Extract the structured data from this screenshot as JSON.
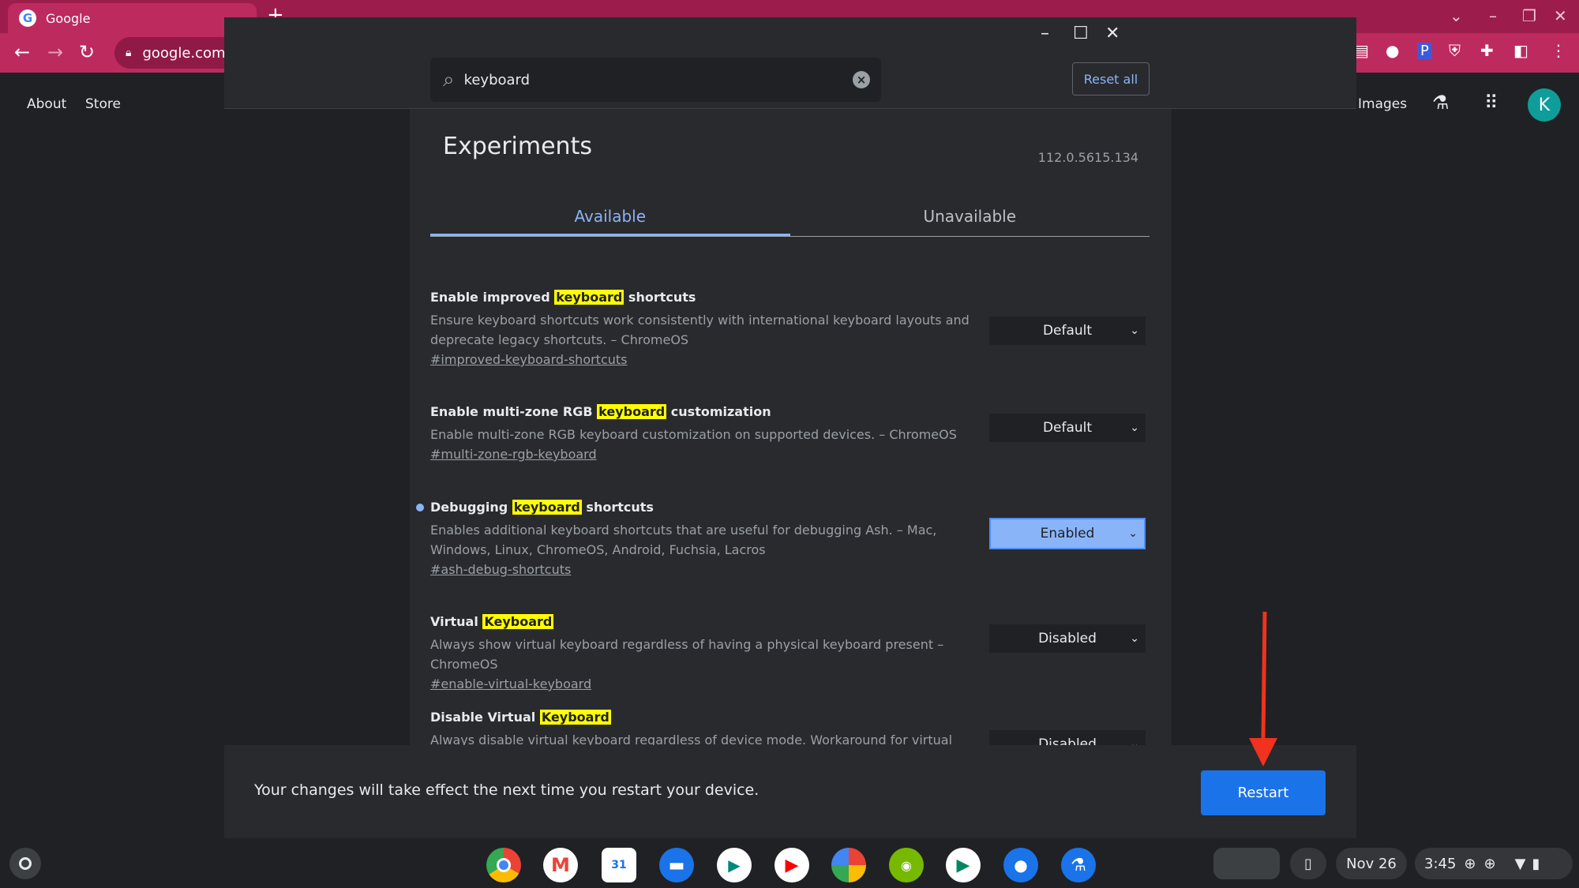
{
  "browser": {
    "tab_title": "Google",
    "url": "google.com",
    "page_links": [
      "About",
      "Store"
    ],
    "images_link": "Images",
    "avatar_letter": "K"
  },
  "flags": {
    "search_value": "keyboard",
    "reset_all_label": "Reset all",
    "title": "Experiments",
    "version": "112.0.5615.134",
    "tabs": [
      "Available",
      "Unavailable"
    ],
    "experiments": [
      {
        "name_pre": "Enable improved ",
        "name_highlight": "keyboard",
        "name_post": " shortcuts",
        "description": "Ensure keyboard shortcuts work consistently with international keyboard layouts and deprecate legacy shortcuts. – ChromeOS",
        "link": "#improved-keyboard-shortcuts",
        "value": "Default"
      },
      {
        "name_pre": "Enable multi-zone RGB ",
        "name_highlight": "keyboard",
        "name_post": " customization",
        "description": "Enable multi-zone RGB keyboard customization on supported devices. – ChromeOS",
        "link": "#multi-zone-rgb-keyboard",
        "value": "Default"
      },
      {
        "name_pre": "Debugging ",
        "name_highlight": "keyboard",
        "name_post": " shortcuts",
        "description": "Enables additional keyboard shortcuts that are useful for debugging Ash. – Mac, Windows, Linux, ChromeOS, Android, Fuchsia, Lacros",
        "link": "#ash-debug-shortcuts",
        "value": "Enabled"
      },
      {
        "name_pre": "Virtual ",
        "name_highlight": "Keyboard",
        "name_post": "",
        "description": "Always show virtual keyboard regardless of having a physical keyboard present – ChromeOS",
        "link": "#enable-virtual-keyboard",
        "value": "Disabled"
      },
      {
        "name_pre": "Disable Virtual ",
        "name_highlight": "Keyboard",
        "name_post": "",
        "description": "Always disable virtual keyboard regardless of device mode. Workaround for virtual keyboard showing with some external keyboards. – ChromeOS",
        "link": "",
        "value": "Disabled"
      }
    ],
    "restart_message": "Your changes will take effect the next time you restart your device.",
    "restart_label": "Restart"
  },
  "shelf": {
    "date": "Nov 26",
    "time": "3:45",
    "apps": [
      "chrome-icon",
      "gmail-icon",
      "calendar-icon",
      "files-icon",
      "meet-icon",
      "youtube-icon",
      "photos-icon",
      "nvidia-icon",
      "play-store-icon",
      "messages-icon",
      "flags-icon"
    ]
  }
}
